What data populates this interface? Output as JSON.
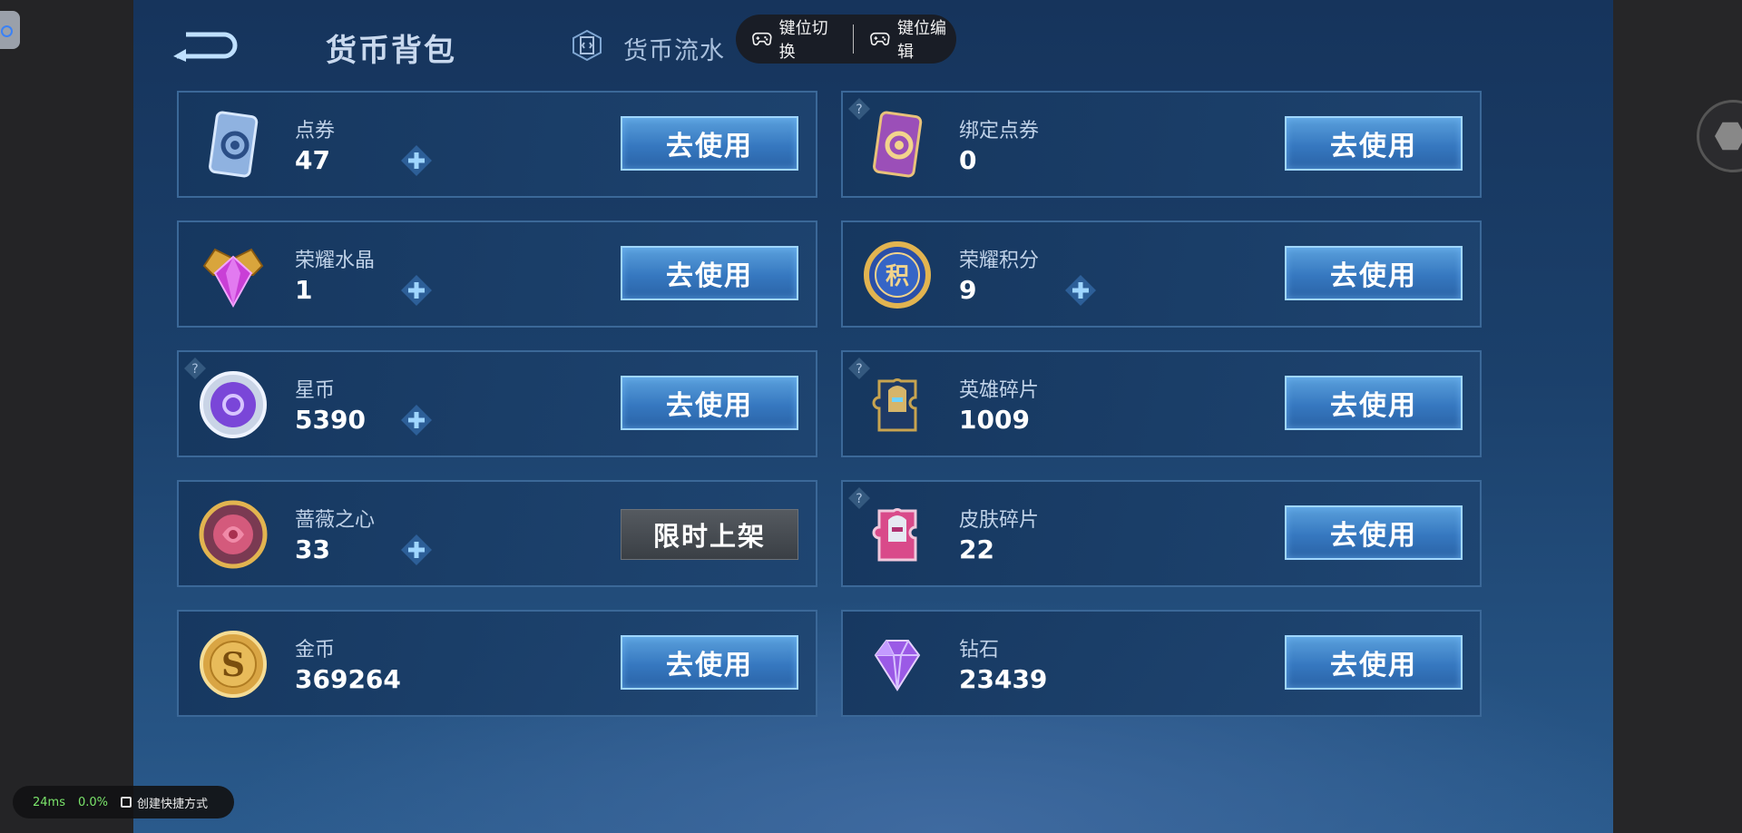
{
  "nav": {
    "title": "货币背包",
    "flow_tab": "货币流水"
  },
  "toolbar": {
    "key_switch": "键位切换",
    "key_edit": "键位编辑"
  },
  "cards": [
    {
      "name": "点券",
      "amount": "47",
      "action": "去使用"
    },
    {
      "name": "绑定点券",
      "amount": "0",
      "action": "去使用"
    },
    {
      "name": "荣耀水晶",
      "amount": "1",
      "action": "去使用"
    },
    {
      "name": "荣耀积分",
      "amount": "9",
      "action": "去使用"
    },
    {
      "name": "星币",
      "amount": "5390",
      "action": "去使用"
    },
    {
      "name": "英雄碎片",
      "amount": "1009",
      "action": "去使用"
    },
    {
      "name": "蔷薇之心",
      "amount": "33",
      "action": "限时上架"
    },
    {
      "name": "皮肤碎片",
      "amount": "22",
      "action": "去使用"
    },
    {
      "name": "金币",
      "amount": "369264",
      "action": "去使用"
    },
    {
      "name": "钻石",
      "amount": "23439",
      "action": "去使用"
    }
  ],
  "status": {
    "latency": "24ms",
    "cpu": "0.0%",
    "shortcut": "创建快捷方式"
  },
  "colors": {
    "use_button": "#3a7cc4",
    "panel": "#1d4373",
    "limited_button": "#4a4f55"
  },
  "icons": [
    "back-arrow-icon",
    "currency-flow-icon",
    "gamepad-icon",
    "help-icon",
    "plus-icon",
    "voucher-icon",
    "bound-voucher-icon",
    "glory-crystal-icon",
    "glory-points-icon",
    "star-coin-icon",
    "hero-fragment-icon",
    "rose-heart-icon",
    "skin-fragment-icon",
    "gold-coin-icon",
    "diamond-icon"
  ]
}
